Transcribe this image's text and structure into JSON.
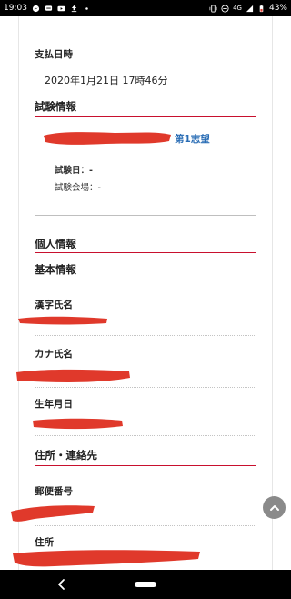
{
  "status_bar": {
    "time": "19:03",
    "battery": "43%",
    "network": "4G"
  },
  "payment": {
    "label": "支払日時",
    "value": "2020年1月21日 17時46分"
  },
  "exam": {
    "section_title": "試験情報",
    "choice_label": "第1志望",
    "date_label": "試験日：-",
    "venue_label": "試験会場：-"
  },
  "personal": {
    "section_title": "個人情報",
    "basic_title": "基本情報",
    "kanji_name_label": "漢字氏名",
    "kana_name_label": "カナ氏名",
    "birthdate_label": "生年月日"
  },
  "address": {
    "section_title": "住所・連絡先",
    "postal_label": "郵便番号",
    "address_label": "住所"
  },
  "colors": {
    "accent_red": "#c8102e",
    "redaction": "#e0392b",
    "link_blue": "#2a6db5"
  }
}
